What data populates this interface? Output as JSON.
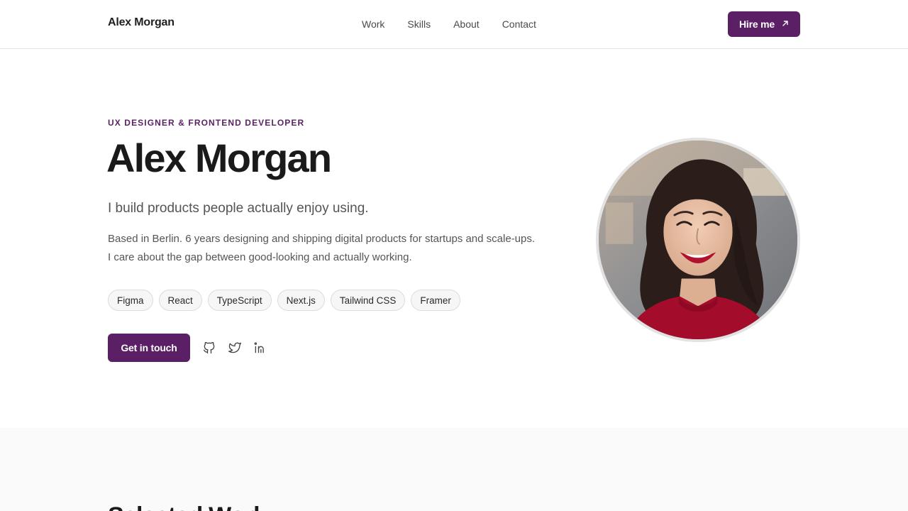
{
  "nav": {
    "brand": "Alex Morgan",
    "links": [
      "Work",
      "Skills",
      "About",
      "Contact"
    ],
    "hire_label": "Hire me",
    "hire_icon": "arrow-up-right-icon"
  },
  "hero": {
    "eyebrow": "UX DESIGNER & FRONTEND DEVELOPER",
    "name": "Alex Morgan",
    "tagline": "I build products people actually enjoy using.",
    "bio_line1": "Based in Berlin. 6 years designing and shipping digital products for startups and scale-ups.",
    "bio_line2": "I care about the gap between good-looking and actually working.",
    "tags": [
      "Figma",
      "React",
      "TypeScript",
      "Next.js",
      "Tailwind CSS",
      "Framer"
    ],
    "cta_label": "Get in touch",
    "social_icons": [
      "github-icon",
      "twitter-icon",
      "linkedin-icon"
    ]
  },
  "work": {
    "title": "Selected Work"
  },
  "colors": {
    "accent": "#5b1f66",
    "text": "#1a1a1a",
    "muted": "#555555",
    "border": "#e3e3e3"
  }
}
